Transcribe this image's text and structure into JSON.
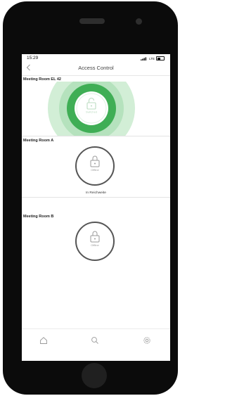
{
  "status": {
    "time": "15:29",
    "network": "LTE"
  },
  "nav": {
    "title": "Access Control"
  },
  "rooms": [
    {
      "name": "Meeting Room EL 42",
      "lock_label": "Switched",
      "state": "unlocked",
      "subtitle": ""
    },
    {
      "name": "Meeting Room A",
      "lock_label": "Offline",
      "state": "offline",
      "subtitle": "In Reichweite"
    },
    {
      "name": "Meeting Room B",
      "lock_label": "Offline",
      "state": "offline",
      "subtitle": ""
    }
  ],
  "tabs": [
    {
      "icon": "home-icon"
    },
    {
      "icon": "search-icon"
    },
    {
      "icon": "settings-icon"
    }
  ],
  "colors": {
    "accent_green": "#3fae55",
    "ring_light": "#c7e9cc",
    "ring_mid": "#9fd8aa",
    "ring_gray": "#555555"
  }
}
